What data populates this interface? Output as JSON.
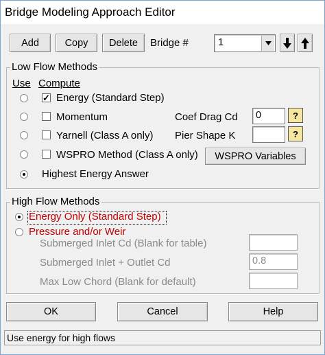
{
  "window": {
    "title": "Bridge Modeling Approach Editor"
  },
  "toolbar": {
    "add_label": "Add",
    "copy_label": "Copy",
    "delete_label": "Delete",
    "bridge_label": "Bridge #",
    "bridge_value": "1",
    "down_arrow": "⬇",
    "up_arrow": "⬆"
  },
  "low_flow": {
    "title": "Low Flow Methods",
    "use_header": "Use",
    "compute_header": "Compute",
    "methods": [
      {
        "label": "Energy (Standard Step)",
        "checked": true,
        "selected": false
      },
      {
        "label": "Momentum",
        "checked": false,
        "selected": false
      },
      {
        "label": "Yarnell (Class A only)",
        "checked": false,
        "selected": false
      },
      {
        "label": "WSPRO Method (Class A only)",
        "checked": false,
        "selected": false
      }
    ],
    "highest_energy_label": "Highest Energy Answer",
    "coef_drag_label": "Coef Drag Cd",
    "coef_drag_value": "0",
    "pier_shape_label": "Pier Shape K",
    "pier_shape_value": "",
    "wspro_button": "WSPRO Variables",
    "help_glyph": "?"
  },
  "high_flow": {
    "title": "High Flow Methods",
    "energy_only_label": "Energy Only (Standard Step)",
    "pressure_weir_label": "Pressure and/or Weir",
    "submerged_inlet_label": "Submerged Inlet Cd (Blank for table)",
    "submerged_inlet_value": "",
    "submerged_outlet_label": "Submerged Inlet + Outlet Cd",
    "submerged_outlet_value": "0.8",
    "max_low_chord_label": "Max Low Chord (Blank for default)",
    "max_low_chord_value": "",
    "accent_color": "#c00000"
  },
  "footer": {
    "ok_label": "OK",
    "cancel_label": "Cancel",
    "help_label": "Help"
  },
  "status_text": "Use energy for high flows"
}
